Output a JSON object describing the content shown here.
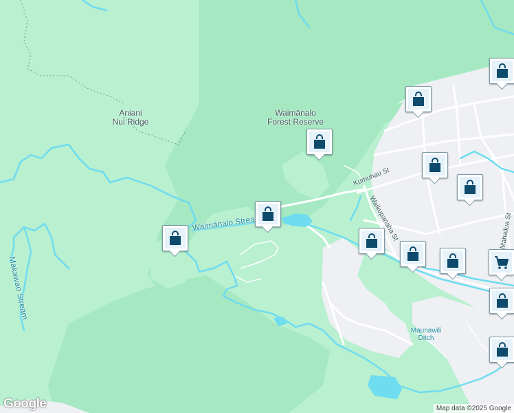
{
  "map": {
    "colors": {
      "land": "#b8f0d0",
      "forest": "#a5e8c1",
      "urban": "#eef0f3",
      "road": "#ffffff",
      "water": "#6fdcef",
      "marker_icon": "#0d4a6b"
    },
    "labels": {
      "ridge": [
        "Aniani",
        "Nui Ridge"
      ],
      "reserve": [
        "Waimānalo",
        "Forest Reserve"
      ],
      "stream": "Waimānalo Stream",
      "makawao": "Makawao Stream",
      "kumuhau": "Kumuhau St",
      "waikupanaha": "Waikupanaha St",
      "mahailua": "Mahailua St",
      "ditch": [
        "Maunawili",
        "Ditch"
      ]
    },
    "markers": [
      {
        "icon": "shopping-bag-icon"
      },
      {
        "icon": "shopping-bag-icon"
      },
      {
        "icon": "shopping-bag-icon"
      },
      {
        "icon": "shopping-bag-icon"
      },
      {
        "icon": "shopping-bag-icon"
      },
      {
        "icon": "shopping-bag-icon"
      },
      {
        "icon": "shopping-bag-icon"
      },
      {
        "icon": "shopping-bag-icon"
      },
      {
        "icon": "shopping-bag-icon"
      },
      {
        "icon": "shopping-bag-icon"
      },
      {
        "icon": "shopping-cart-icon"
      },
      {
        "icon": "shopping-bag-icon"
      },
      {
        "icon": "shopping-bag-icon"
      }
    ],
    "logo": "Google",
    "attribution": "Map data ©2025 Google"
  }
}
